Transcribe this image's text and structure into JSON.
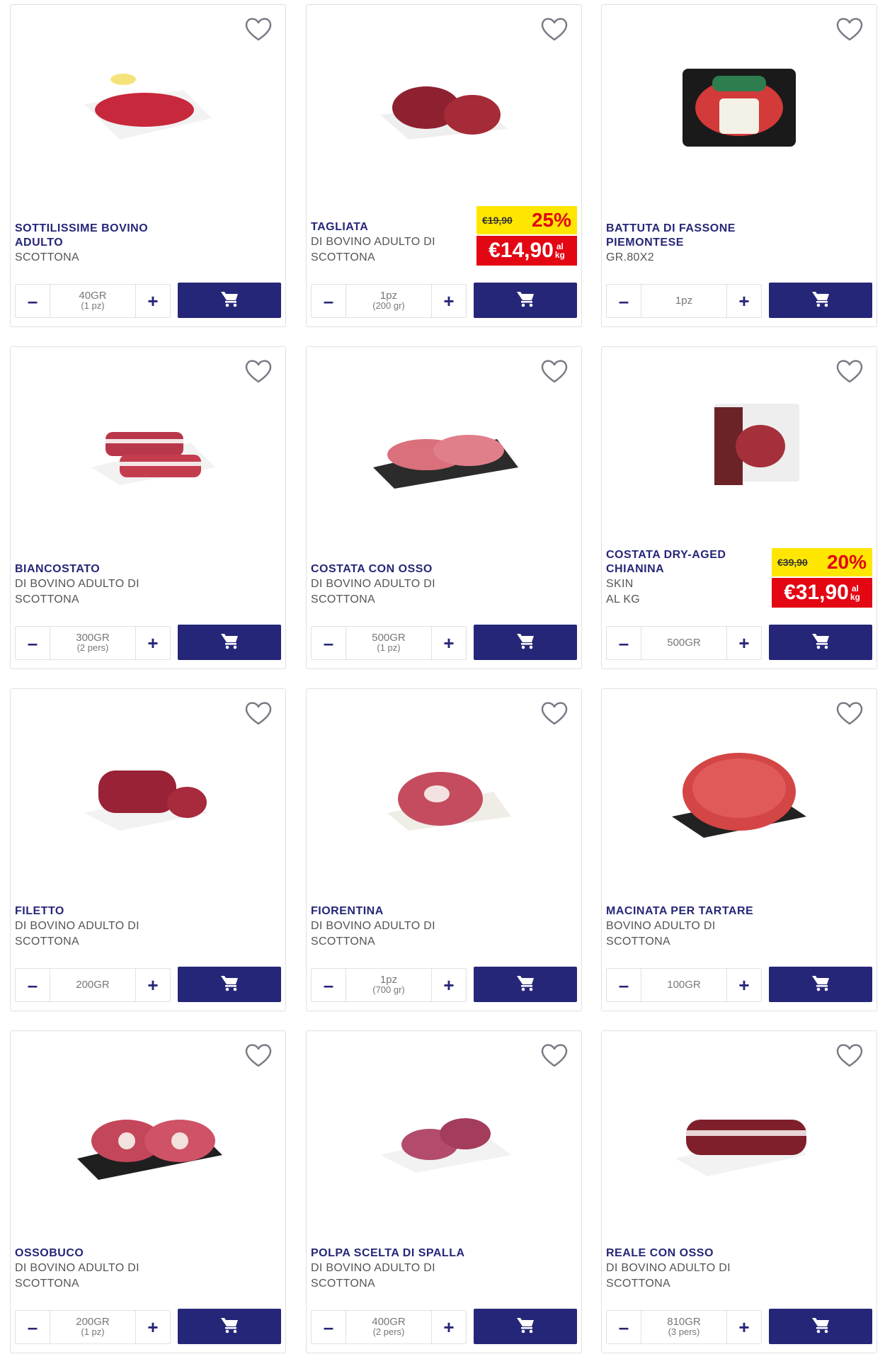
{
  "colors": {
    "brand": "#262679",
    "sale_red": "#e30613",
    "sale_yellow": "#ffe600"
  },
  "icons": {
    "favorite": "heart-outline-icon",
    "cart": "shopping-cart-icon",
    "minus": "minus-icon",
    "plus": "plus-icon"
  },
  "controls": {
    "minus_label": "–",
    "plus_label": "+"
  },
  "products": [
    {
      "name": "SOTTILISSIME BOVINO ADULTO",
      "sub1": "SCOTTONA",
      "sub2": "",
      "qty1": "40GR",
      "qty2": "(1 pz)",
      "promo": null
    },
    {
      "name": "TAGLIATA",
      "sub1": "DI BOVINO ADULTO DI",
      "sub2": "SCOTTONA",
      "qty1": "1pz",
      "qty2": "(200 gr)",
      "promo": {
        "old_price": "€19,90",
        "discount": "25%",
        "new_price": "€14,90",
        "unit_top": "al",
        "unit_bot": "kg"
      }
    },
    {
      "name": "BATTUTA DI FASSONE PIEMONTESE",
      "sub1": "GR.80X2",
      "sub2": "",
      "qty1": "1pz",
      "qty2": "",
      "promo": null
    },
    {
      "name": "BIANCOSTATO",
      "sub1": "DI BOVINO ADULTO DI",
      "sub2": "SCOTTONA",
      "qty1": "300GR",
      "qty2": "(2 pers)",
      "promo": null
    },
    {
      "name": "COSTATA CON OSSO",
      "sub1": "DI BOVINO ADULTO DI",
      "sub2": "SCOTTONA",
      "qty1": "500GR",
      "qty2": "(1 pz)",
      "promo": null
    },
    {
      "name": "COSTATA DRY-AGED CHIANINA",
      "sub1": "SKIN",
      "sub2": "AL KG",
      "qty1": "500GR",
      "qty2": "",
      "promo": {
        "old_price": "€39,90",
        "discount": "20%",
        "new_price": "€31,90",
        "unit_top": "al",
        "unit_bot": "kg"
      }
    },
    {
      "name": "FILETTO",
      "sub1": "DI BOVINO ADULTO DI",
      "sub2": "SCOTTONA",
      "qty1": "200GR",
      "qty2": "",
      "promo": null
    },
    {
      "name": "FIORENTINA",
      "sub1": "DI BOVINO ADULTO DI",
      "sub2": "SCOTTONA",
      "qty1": "1pz",
      "qty2": "(700 gr)",
      "promo": null
    },
    {
      "name": "MACINATA PER TARTARE",
      "sub1": "BOVINO ADULTO DI",
      "sub2": "SCOTTONA",
      "qty1": "100GR",
      "qty2": "",
      "promo": null
    },
    {
      "name": "OSSOBUCO",
      "sub1": "DI BOVINO ADULTO DI",
      "sub2": "SCOTTONA",
      "qty1": "200GR",
      "qty2": "(1 pz)",
      "promo": null
    },
    {
      "name": "POLPA SCELTA DI SPALLA",
      "sub1": "DI BOVINO ADULTO DI",
      "sub2": "SCOTTONA",
      "qty1": "400GR",
      "qty2": "(2 pers)",
      "promo": null
    },
    {
      "name": "REALE CON OSSO",
      "sub1": "DI BOVINO ADULTO DI",
      "sub2": "SCOTTONA",
      "qty1": "810GR",
      "qty2": "(3 pers)",
      "promo": null
    }
  ]
}
